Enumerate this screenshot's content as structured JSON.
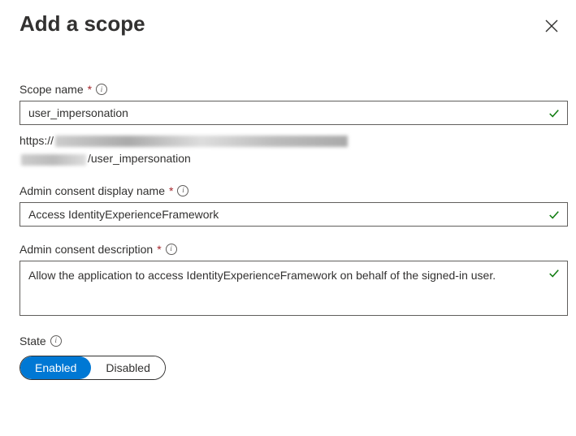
{
  "title": "Add a scope",
  "scope": {
    "label": "Scope name",
    "value": "user_impersonation",
    "uri_prefix": "https://",
    "uri_suffix": "/user_impersonation"
  },
  "admin_display": {
    "label": "Admin consent display name",
    "value": "Access IdentityExperienceFramework"
  },
  "admin_desc": {
    "label": "Admin consent description",
    "value": "Allow the application to access IdentityExperienceFramework on behalf of the signed-in user."
  },
  "state": {
    "label": "State",
    "enabled": "Enabled",
    "disabled": "Disabled",
    "value": "Enabled"
  }
}
